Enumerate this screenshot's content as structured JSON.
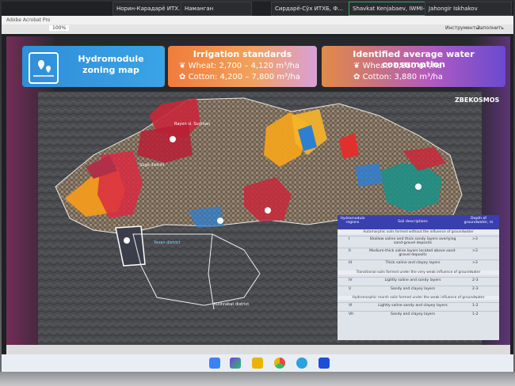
{
  "meeting_strip": {
    "participants": [
      {
        "name": "Норин-Карадарё ИТХ..."
      },
      {
        "name": "Наманган"
      },
      {
        "name": "Сирдарё-Сўх ИТХБ, Ф..."
      },
      {
        "name": "Shavkat Kenjabaev, IWMI-..."
      },
      {
        "name": "Jahongir Iskhakov"
      }
    ]
  },
  "window": {
    "title": "Adobe Acrobat Pro",
    "toolbar_zoom": "100%",
    "toolbar_tools_label": "Инструменты",
    "toolbar_fill_label": "Заполнить"
  },
  "slide": {
    "title": "Hydromodule zoning map",
    "standards": {
      "heading": "Irrigation standards",
      "wheat": "Wheat: 2,700 – 4,120 m³/ha",
      "cotton": "Cotton: 4,200 – 7,800 m³/ha"
    },
    "consumption": {
      "heading": "Identified average water consumption",
      "wheat": "Wheat: 1,850 m³/ha",
      "cotton": "Cotton: 3,880 m³/ha"
    },
    "brand": "ZBEKOSMOS",
    "map_labels": [
      {
        "text": "Rayon sl. Surkhan"
      },
      {
        "text": "Sugd district"
      },
      {
        "text": "Yavan district"
      },
      {
        "text": "Kushrabat district"
      }
    ],
    "legend": {
      "headers": [
        "Hydromodule regions",
        "Soil descriptions",
        "Depth of groundwater, m"
      ],
      "sections": [
        "Automorphic soils formed without the influence of groundwater",
        "Transitional soils formed under the very weak influence of groundwater",
        "Hydromorphic marsh soils formed under the weak influence of groundwater"
      ],
      "rows": [
        {
          "region": "I",
          "desc": "Shallow saline and thick sandy layers overlying sand-gravel deposits",
          "depth": ">3"
        },
        {
          "region": "II",
          "desc": "Medium-thick saline layers located above sand-gravel deposits",
          "depth": ">3"
        },
        {
          "region": "III",
          "desc": "Thick saline and clayey layers",
          "depth": ">3"
        },
        {
          "region": "IV",
          "desc": "Lightly saline and sandy layers",
          "depth": "2-3"
        },
        {
          "region": "V",
          "desc": "Sandy and clayey layers",
          "depth": "2-3"
        },
        {
          "region": "VI",
          "desc": "Lightly saline sandy and clayey layers",
          "depth": "1-2"
        },
        {
          "region": "VII",
          "desc": "Sandy and clayey layers",
          "depth": "1-2"
        }
      ]
    }
  },
  "colors": {
    "title_card": "#2f8fd8",
    "standards_card": "#f07c3c",
    "consumption_card": "#8a4ed0",
    "legend_header": "#3a3fb0",
    "zone_red": "#c8283a",
    "zone_orange": "#f29a1e",
    "zone_blue": "#2f7fd0",
    "zone_teal": "#1e8f86"
  }
}
